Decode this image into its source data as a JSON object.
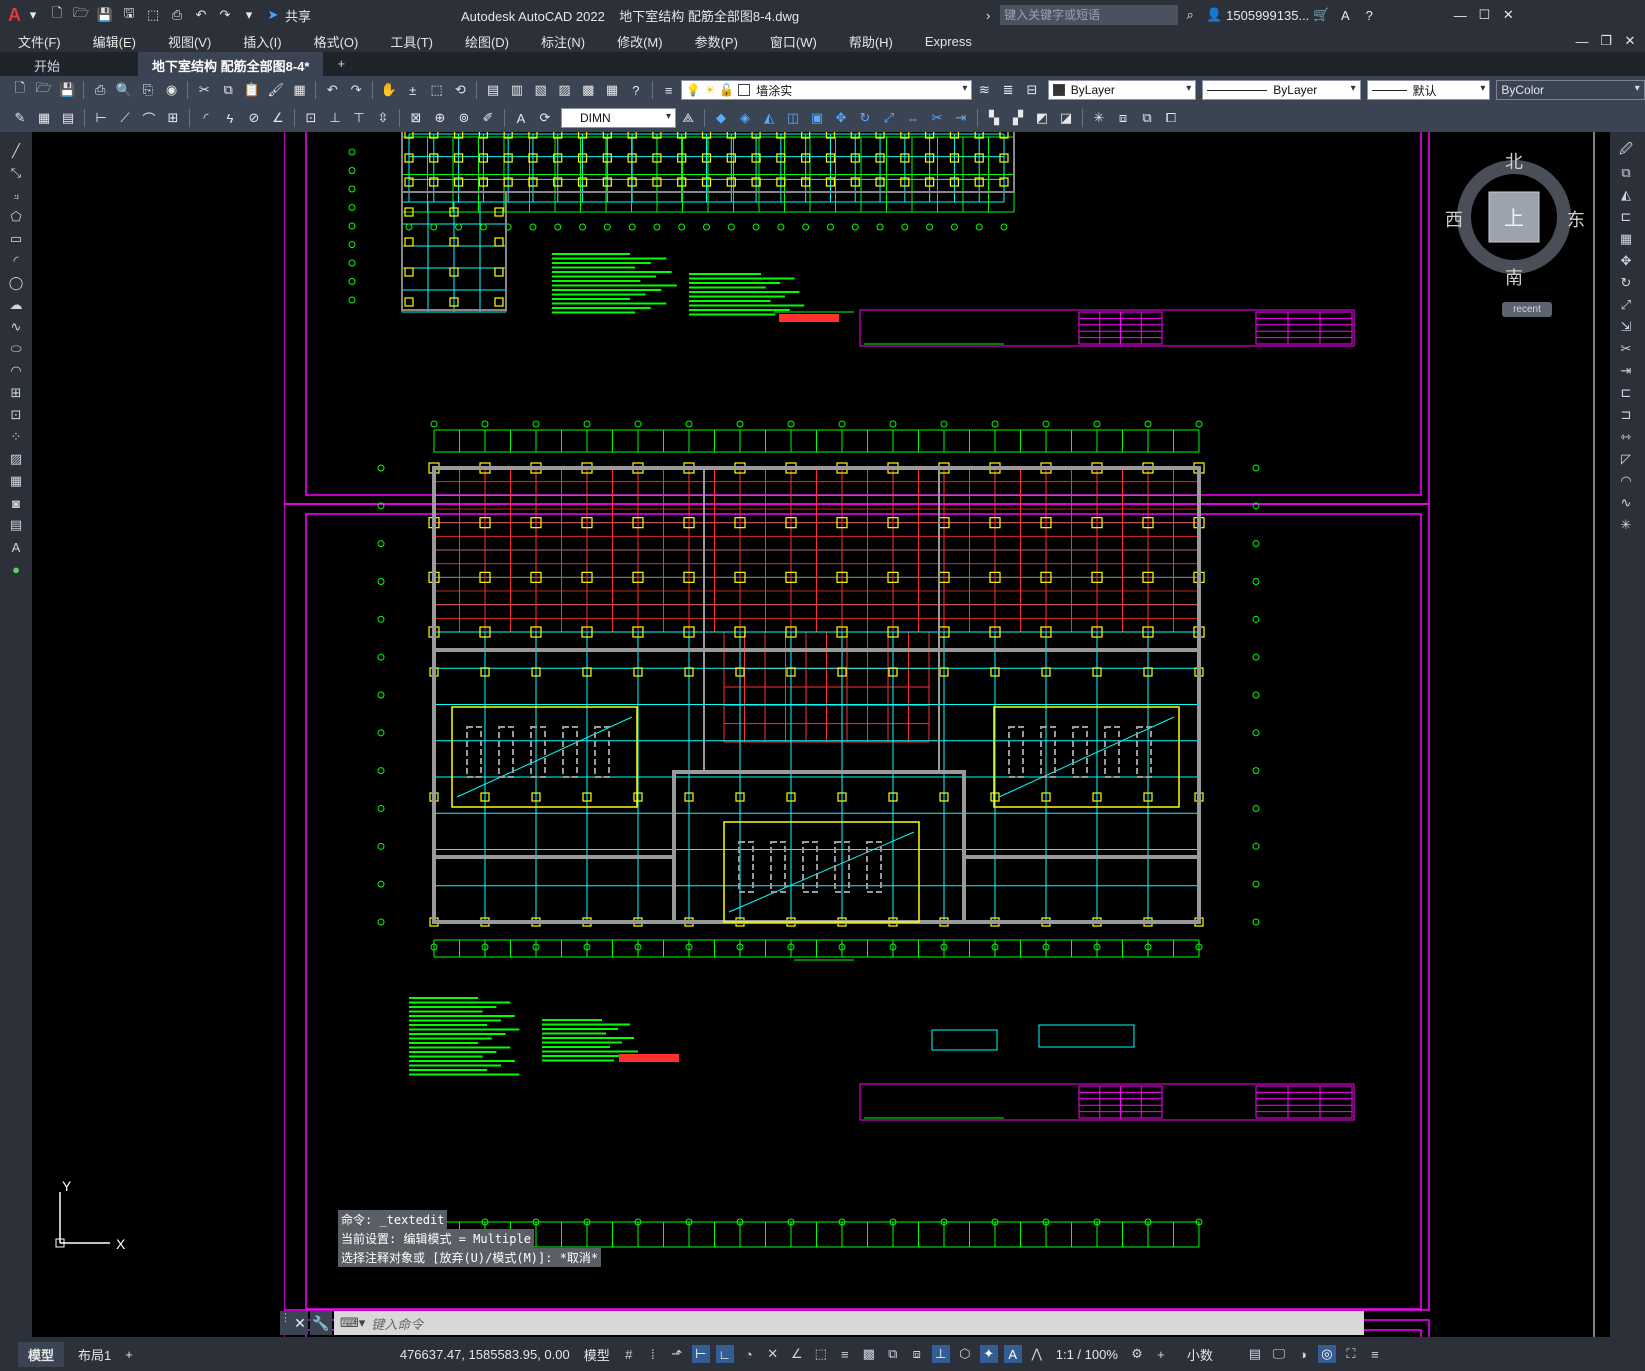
{
  "title_bar": {
    "app_logo": "A",
    "share_label": "共享",
    "window_title": "Autodesk AutoCAD 2022    地下室结构 配筋全部图8-4.dwg",
    "search_placeholder": "键入关键字或短语",
    "user": "1505999135...",
    "help_icon": "?"
  },
  "menu": [
    "文件(F)",
    "编辑(E)",
    "视图(V)",
    "插入(I)",
    "格式(O)",
    "工具(T)",
    "绘图(D)",
    "标注(N)",
    "修改(M)",
    "参数(P)",
    "窗口(W)",
    "帮助(H)",
    "Express"
  ],
  "tabs": {
    "start": "开始",
    "active": "地下室结构 配筋全部图8-4*",
    "add": "+"
  },
  "toolbar": {
    "layer": "墙涂实",
    "color": "ByLayer",
    "linetype": "ByLayer",
    "lineweight": "默认",
    "plotstyle": "ByColor",
    "dimstyle": "DIMN"
  },
  "viewcube": {
    "north": "北",
    "south": "南",
    "east": "东",
    "west": "西",
    "face": "上",
    "recent": "recent"
  },
  "ucs": {
    "y": "Y",
    "x": "X"
  },
  "command": {
    "history": [
      "命令: _textedit",
      "当前设置: 编辑模式 = Multiple",
      "选择注释对象或 [放弃(U)/模式(M)]: *取消*"
    ],
    "placeholder": "键入命令"
  },
  "layout_tabs": [
    "模型",
    "布局1",
    "+"
  ],
  "status": {
    "coords": "476637.47, 1585583.95, 0.00",
    "space": "模型",
    "scale": "1:1 / 100%",
    "units": "小数"
  },
  "colors": {
    "accent": "#345d93",
    "border_magenta": "#ff00ff",
    "grid_green": "#00ff00",
    "grid_cyan": "#00ffff",
    "grid_red": "#ff3030",
    "grid_yellow": "#ffff00"
  }
}
